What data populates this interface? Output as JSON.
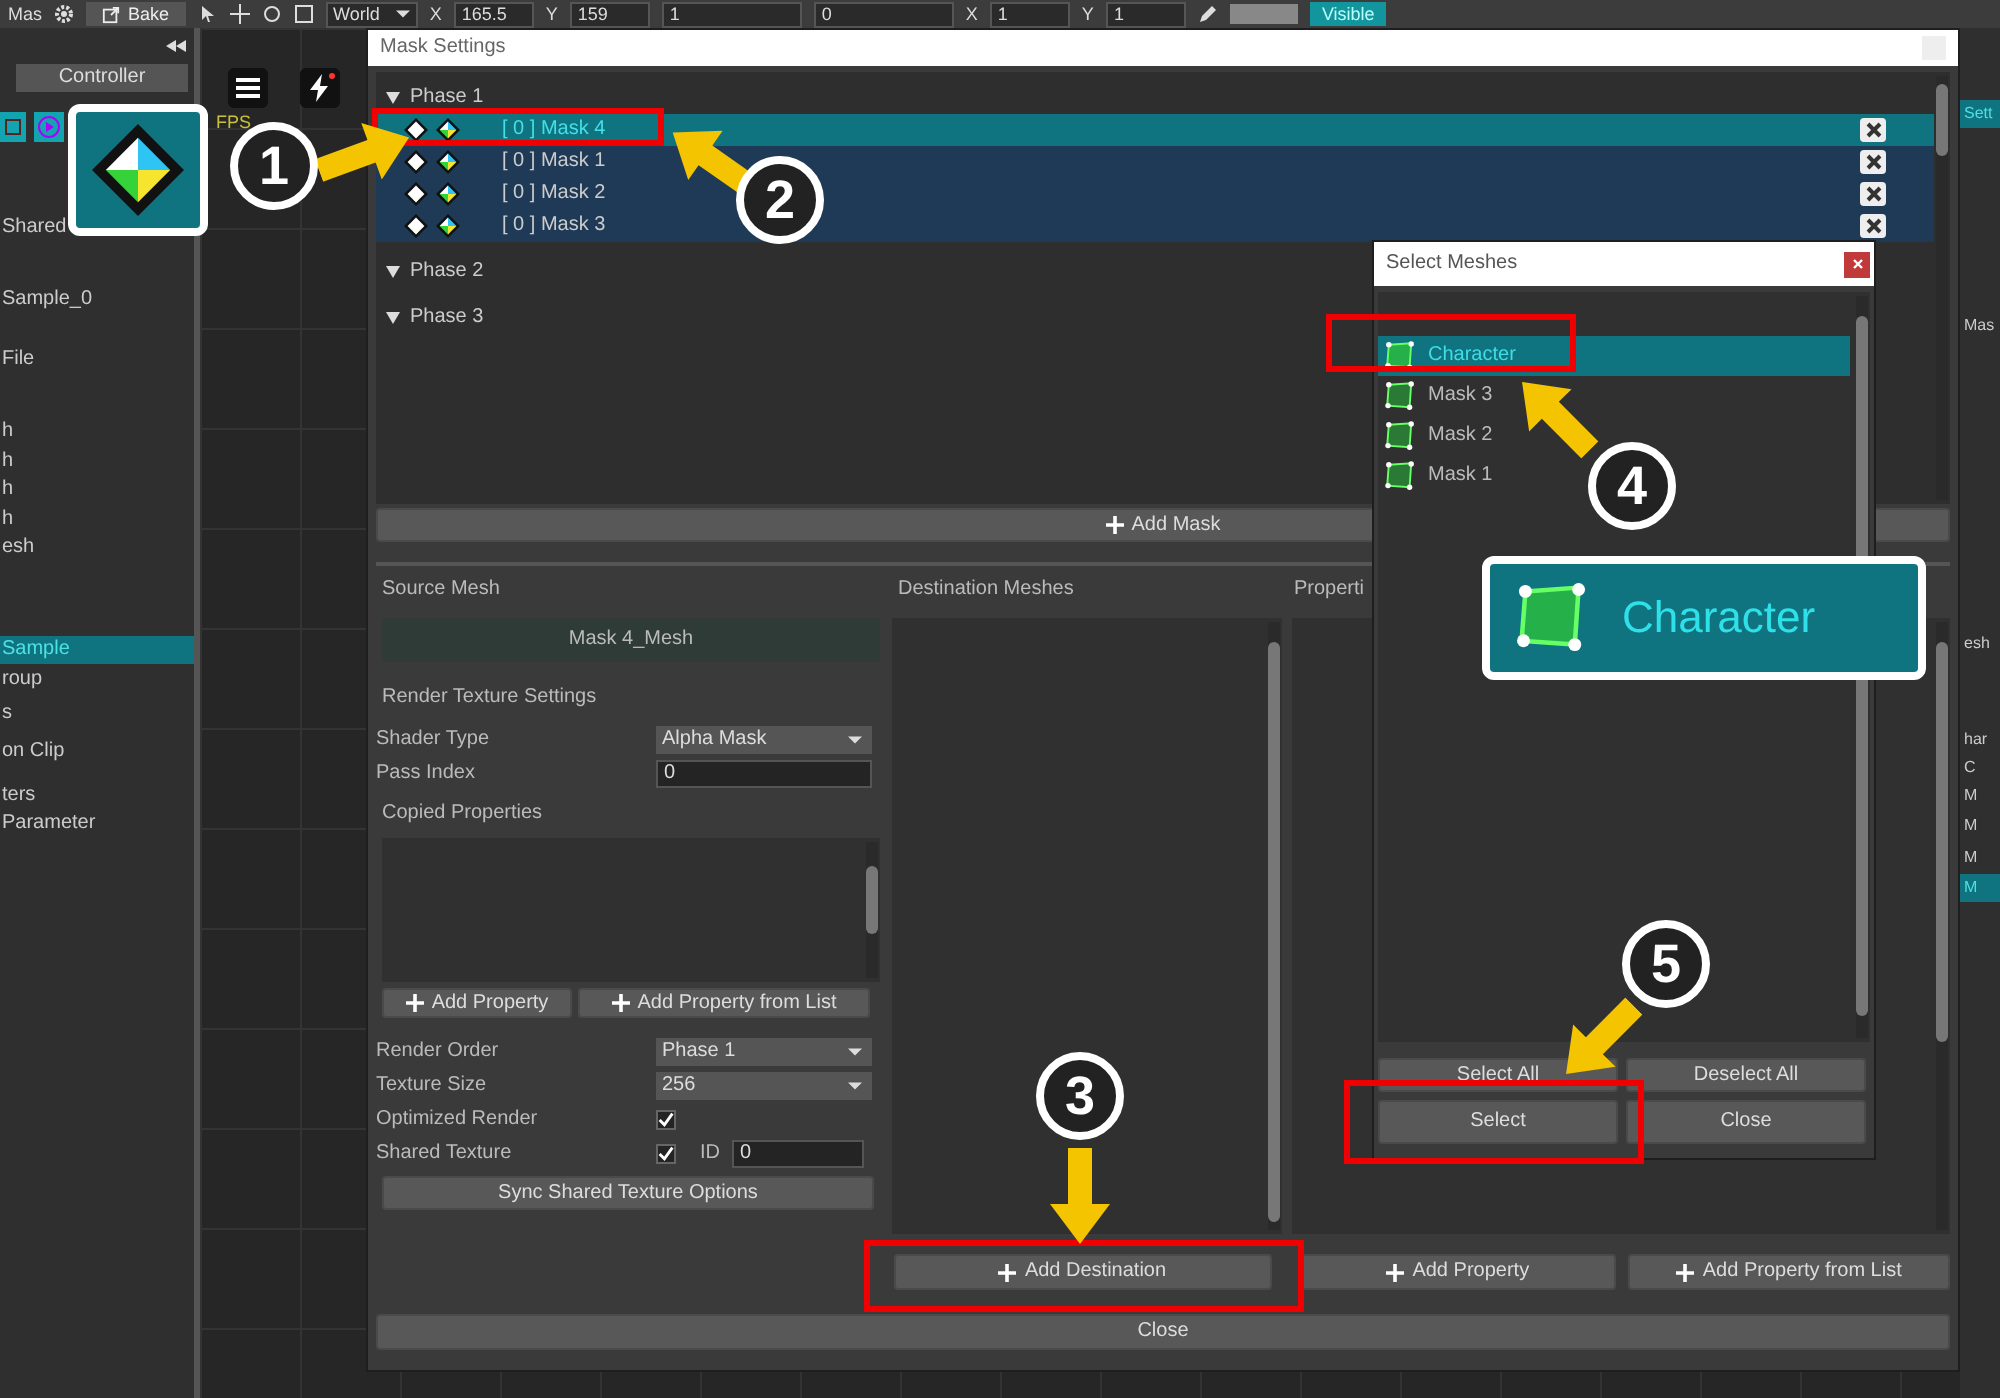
{
  "toolbar": {
    "document_tab": "Mas",
    "bake_button": "Bake",
    "space_dropdown": "World",
    "fields": [
      {
        "label": "X",
        "value": "165.5"
      },
      {
        "label": "Y",
        "value": "159"
      },
      {
        "value": "1"
      },
      {
        "value": "0"
      },
      {
        "label": "X",
        "value": "1"
      },
      {
        "label": "Y",
        "value": "1"
      }
    ],
    "visible_toggle": "Visible"
  },
  "left_panel": {
    "controller_tab": "Controller",
    "items": [
      {
        "text": "Shared",
        "selected": false
      },
      {
        "text": "Sample_0",
        "selected": false
      },
      {
        "text": "File",
        "selected": false
      },
      {
        "text": "h",
        "selected": false
      },
      {
        "text": "h",
        "selected": false
      },
      {
        "text": "h",
        "selected": false
      },
      {
        "text": "h",
        "selected": false
      },
      {
        "text": "esh",
        "selected": false
      },
      {
        "text": "Sample",
        "selected": true
      },
      {
        "text": "roup",
        "selected": false
      },
      {
        "text": "s",
        "selected": false
      },
      {
        "text": "on Clip",
        "selected": false
      },
      {
        "text": "ters",
        "selected": false
      },
      {
        "text": "Parameter",
        "selected": false
      }
    ]
  },
  "viewport": {
    "fps": "FPS"
  },
  "right_panel": {
    "items": [
      {
        "text": "Sett",
        "selected": true
      },
      {
        "text": "Mas",
        "selected": false
      },
      {
        "text": "esh",
        "selected": false
      },
      {
        "text": "har",
        "selected": false
      },
      {
        "text": "C",
        "selected": false
      },
      {
        "text": "M",
        "selected": false
      },
      {
        "text": "M",
        "selected": false
      },
      {
        "text": "M",
        "selected": false
      },
      {
        "text": "M",
        "selected": true
      }
    ]
  },
  "mask_settings": {
    "title": "Mask Settings",
    "phases": [
      {
        "name": "Phase 1",
        "masks": [
          {
            "label": "[ 0 ] Mask 4",
            "selected": true
          },
          {
            "label": "[ 0 ] Mask 1",
            "selected": false
          },
          {
            "label": "[ 0 ] Mask 2",
            "selected": false
          },
          {
            "label": "[ 0 ] Mask 3",
            "selected": false
          }
        ]
      },
      {
        "name": "Phase 2"
      },
      {
        "name": "Phase 3"
      }
    ],
    "add_mask_button": "Add Mask",
    "source_mesh": {
      "label": "Source Mesh",
      "value": "Mask 4_Mesh"
    },
    "render_texture_settings": {
      "heading": "Render Texture Settings",
      "shader_type": {
        "label": "Shader Type",
        "value": "Alpha Mask"
      },
      "pass_index": {
        "label": "Pass Index",
        "value": "0"
      }
    },
    "copied_properties": {
      "heading": "Copied Properties",
      "buttons": [
        "Add Property",
        "Add Property from List"
      ]
    },
    "render_order": {
      "label": "Render Order",
      "value": "Phase 1"
    },
    "texture_size": {
      "label": "Texture Size",
      "value": "256"
    },
    "optimized_render": {
      "label": "Optimized Render",
      "checked": true
    },
    "shared_texture": {
      "label": "Shared Texture",
      "checked": true,
      "id_label": "ID",
      "id_value": "0"
    },
    "sync_button": "Sync Shared Texture Options",
    "destination_meshes": {
      "heading": "Destination Meshes"
    },
    "properties": {
      "heading": "Properti"
    },
    "bottom_buttons": [
      "Add Destination",
      "Add Property",
      "Add Property from List"
    ],
    "close_button": "Close"
  },
  "select_meshes": {
    "title": "Select Meshes",
    "meshes": [
      {
        "name": "Character",
        "selected": true
      },
      {
        "name": "Mask 3",
        "selected": false
      },
      {
        "name": "Mask 2",
        "selected": false
      },
      {
        "name": "Mask 1",
        "selected": false
      }
    ],
    "buttons": [
      "Select All",
      "Deselect All",
      "Select",
      "Close"
    ]
  },
  "annotations": {
    "steps": [
      "1",
      "2",
      "3",
      "4",
      "5"
    ],
    "inset_label": "Character"
  }
}
